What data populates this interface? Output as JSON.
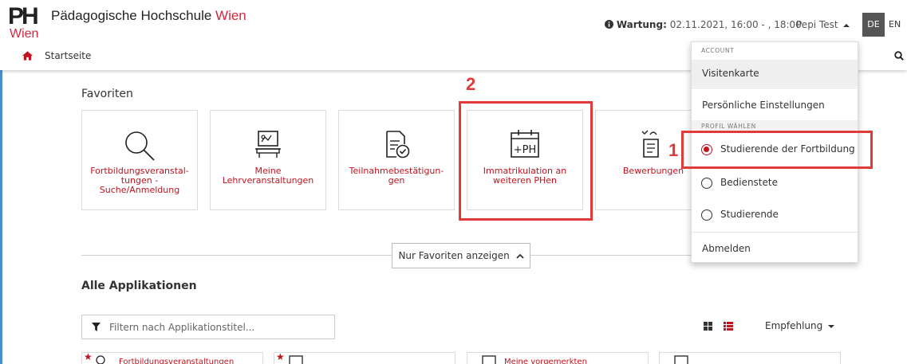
{
  "header": {
    "logo_mark": "PH",
    "logo_city": "Wien",
    "brand_main": "Pädagogische Hochschule ",
    "brand_accent": "Wien",
    "maintenance_label": "Wartung:",
    "maintenance_text": "02.11.2021, 16:00 - , 18:00",
    "user_name": "Pepi Test",
    "lang_de": "DE",
    "lang_en": "EN",
    "colors": {
      "brand_red": "#d7263d",
      "link_red": "#c0141f",
      "highlight": "#e03a3a"
    }
  },
  "nav": {
    "home_label": "Startseite"
  },
  "favorites": {
    "title": "Favoriten",
    "cards": [
      {
        "label": "Fortbildungsveranstal-tungen - Suche/Anmeldung",
        "icon": "magnifier-icon"
      },
      {
        "label": "Meine Lehrveranstaltungen",
        "icon": "lecture-board-icon"
      },
      {
        "label": "Teilnahmebestätigun-gen",
        "icon": "certificate-check-icon"
      },
      {
        "label": "Immatrikulation an weiteren PHen",
        "icon": "calendar-plus-ph-icon"
      },
      {
        "label": "Bewerbungen",
        "icon": "application-icon"
      }
    ]
  },
  "annotations": {
    "marker_1": "1",
    "marker_2": "2"
  },
  "toggle_favorites_label": "Nur Favoriten anzeigen",
  "all_apps": {
    "title": "Alle Applikationen",
    "filter_placeholder": "Filtern nach Applikationstitel...",
    "sort_label": "Empfehlung",
    "cards": [
      {
        "label": "Fortbildungsveranstaltungen"
      },
      {
        "label": ""
      },
      {
        "label": "Meine vorgemerkten"
      },
      {
        "label": ""
      }
    ]
  },
  "dropdown": {
    "account_heading": "ACCOUNT",
    "visitenkarte": "Visitenkarte",
    "settings": "Persönliche Einstellungen",
    "profile_heading": "PROFIL WÄHLEN",
    "profiles": [
      {
        "label": "Studierende der Fortbildung",
        "selected": true
      },
      {
        "label": "Bedienstete",
        "selected": false
      },
      {
        "label": "Studierende",
        "selected": false
      }
    ],
    "logout": "Abmelden"
  }
}
